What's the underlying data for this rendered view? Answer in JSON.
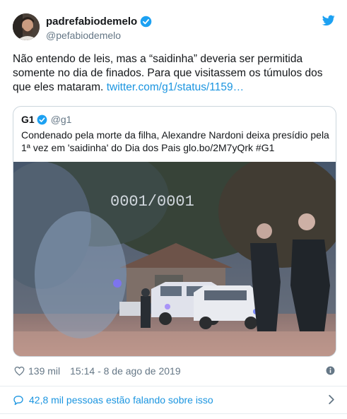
{
  "tweet": {
    "display_name": "padrefabiodemelo",
    "handle": "@pefabiodemelo",
    "text": "Não entendo de leis, mas a “saidinha” deveria ser permitida somente no dia de finados. Para que visitassem os túmulos dos que eles mataram.",
    "link": "twitter.com/g1/status/1159…",
    "likes": "139 mil",
    "timestamp": "15:14 - 8 de ago de 2019",
    "conversation": "42,8 mil pessoas estão falando sobre isso"
  },
  "quoted": {
    "display_name": "G1",
    "handle": "@g1",
    "text": "Condenado pela morte da filha, Alexandre Nardoni deixa presídio pela 1ª vez em 'saidinha' do Dia dos Pais glo.bo/2M7yQrk #G1",
    "media_overlay": "0001/0001"
  },
  "icons": {
    "verified": "verified-badge-icon",
    "twitter": "twitter-bird-icon",
    "like": "heart-icon",
    "info": "info-icon",
    "conversation": "speech-bubble-icon",
    "chevron": "chevron-right-icon"
  },
  "colors": {
    "accent": "#1da1f2",
    "link": "#1b95e0",
    "secondary_text": "#657786",
    "border": "#ccd6dd"
  }
}
